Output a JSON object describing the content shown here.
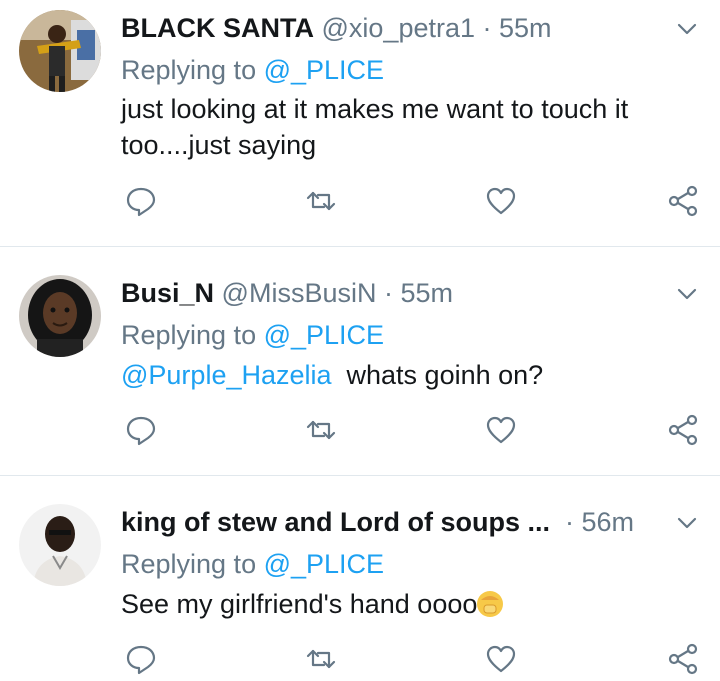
{
  "tweets": [
    {
      "name": "BLACK SANTA",
      "handle": "@xio_petra1",
      "time": "· 55m",
      "replying_prefix": "Replying to ",
      "replying_to": "@_PLICE",
      "text": "just looking at it makes me want to touch it too....just saying"
    },
    {
      "name": "Busi_N",
      "handle": "@MissBusiN",
      "time": "· 55m",
      "replying_prefix": "Replying to ",
      "replying_to": "@_PLICE",
      "text_mention": "@Purple_Hazelia",
      "text": "  whats goinh on?"
    },
    {
      "name": "king of stew and Lord of soups ...",
      "time": "· 56m",
      "replying_prefix": "Replying to ",
      "replying_to": "@_PLICE",
      "text": "See my girlfriend's hand oooo",
      "emoji": "face-palm-emoji"
    }
  ],
  "icons": {
    "reply": "reply-icon",
    "retweet": "retweet-icon",
    "like": "heart-icon",
    "share": "share-icon",
    "menu": "chevron-down-icon"
  },
  "colors": {
    "name": "#14171a",
    "meta": "#657786",
    "mention": "#1da1f2",
    "divider": "#e1e8ed"
  }
}
